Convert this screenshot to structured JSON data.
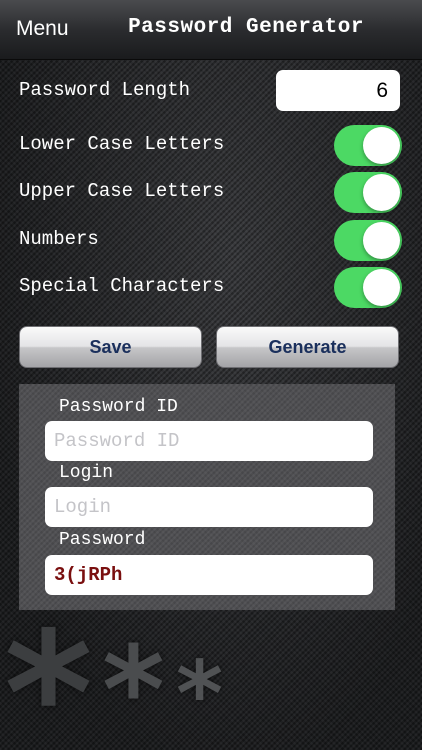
{
  "navbar": {
    "menu_label": "Menu",
    "title": "Password Generator"
  },
  "settings": {
    "length_label": "Password Length",
    "length_value": "6",
    "options": [
      {
        "label": "Lower Case Letters",
        "enabled": true
      },
      {
        "label": "Upper Case Letters",
        "enabled": true
      },
      {
        "label": "Numbers",
        "enabled": true
      },
      {
        "label": "Special Characters",
        "enabled": true
      }
    ]
  },
  "actions": {
    "save_label": "Save",
    "generate_label": "Generate"
  },
  "form": {
    "password_id_label": "Password ID",
    "password_id_placeholder": "Password ID",
    "login_label": "Login",
    "login_placeholder": "Login",
    "password_label": "Password",
    "password_value": "3(jRPh"
  },
  "colors": {
    "toggle_on": "#4cd964",
    "button_text": "#1a2f5c",
    "password_text": "#7a0f0f"
  },
  "decoration": {
    "icon": "asterisk-icon"
  }
}
